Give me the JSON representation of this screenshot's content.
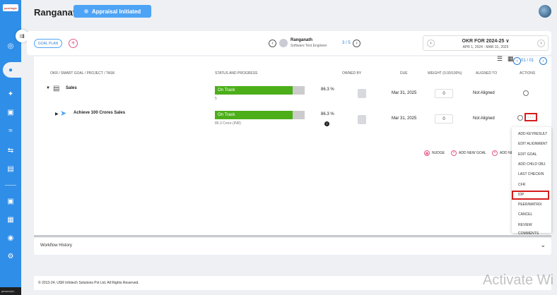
{
  "sidebar": {
    "logo": "peerlogic",
    "toggle_icon": "collapse-arrow-icon"
  },
  "header": {
    "user_name": "Ranganath",
    "appraisal_status": "Appraisal Initiated"
  },
  "goal_bar": {
    "goal_plan_label": "GOAL PLAN",
    "plus_label": "+",
    "employee_name": "Ranganath",
    "employee_title": "Software Test Engineer",
    "employee_count": "3 / 5",
    "okr_title": "OKR FOR 2024-25 ∨",
    "okr_range": "APR 1, 2024 - MAR 31, 2025",
    "prev_arrow": "‹",
    "next_arrow": "›"
  },
  "table": {
    "page_count": "01 / 01",
    "columns": [
      "OKR / SMART GOAL / PROJECT / TASK",
      "STATUS AND PROGRESS",
      "OWNED BY",
      "DUE",
      "WEIGHT (0.00/100%)",
      "ALIGNED TO",
      "ACTIONS"
    ],
    "rows": [
      {
        "name": "Sales",
        "status": "On Track",
        "progress_percent": 86.3,
        "percent_label": "86.3 %",
        "sub_value": "5",
        "due": "Mar 31, 2025",
        "weight": "0",
        "aligned": "Not Aligned"
      },
      {
        "name": "Achieve 100 Crores Sales",
        "status": "On Track",
        "progress_percent": 86.3,
        "percent_label": "86.3 %",
        "sub_value": "86.3 Crore (INR)",
        "due": "Mar 31, 2025",
        "weight": "0",
        "aligned": "Not Aligned"
      }
    ],
    "dots_label": "···",
    "info_label": "i"
  },
  "footer_actions": {
    "nudge": "NUDGE",
    "add_new_goal": "ADD NEW GOAL",
    "add_new_truncated": "ADD NE"
  },
  "action_menu": [
    "ADD KEYRESULT",
    "EDIT ALIGNMENT",
    "EDIT GOAL",
    "ADD CHILD OBJ.",
    "LAST CHECKIN",
    "CFR",
    "IDP",
    "PEER/MATRIX",
    "CANCEL",
    "REVIEW COMMENTS"
  ],
  "workflow": {
    "label": "Workflow History"
  },
  "footer": {
    "copyright": "© 2013-24, USR Infotech Solutions Pvt Ltd. All Rights Reserved."
  },
  "watermark": "Activate Wi",
  "status_bar": "javascript:;",
  "colors": {
    "sidebar": "#2f8ee8",
    "on_track": "#4caf1a",
    "highlight": "#d51d1d",
    "accent": "#4da3f5"
  }
}
